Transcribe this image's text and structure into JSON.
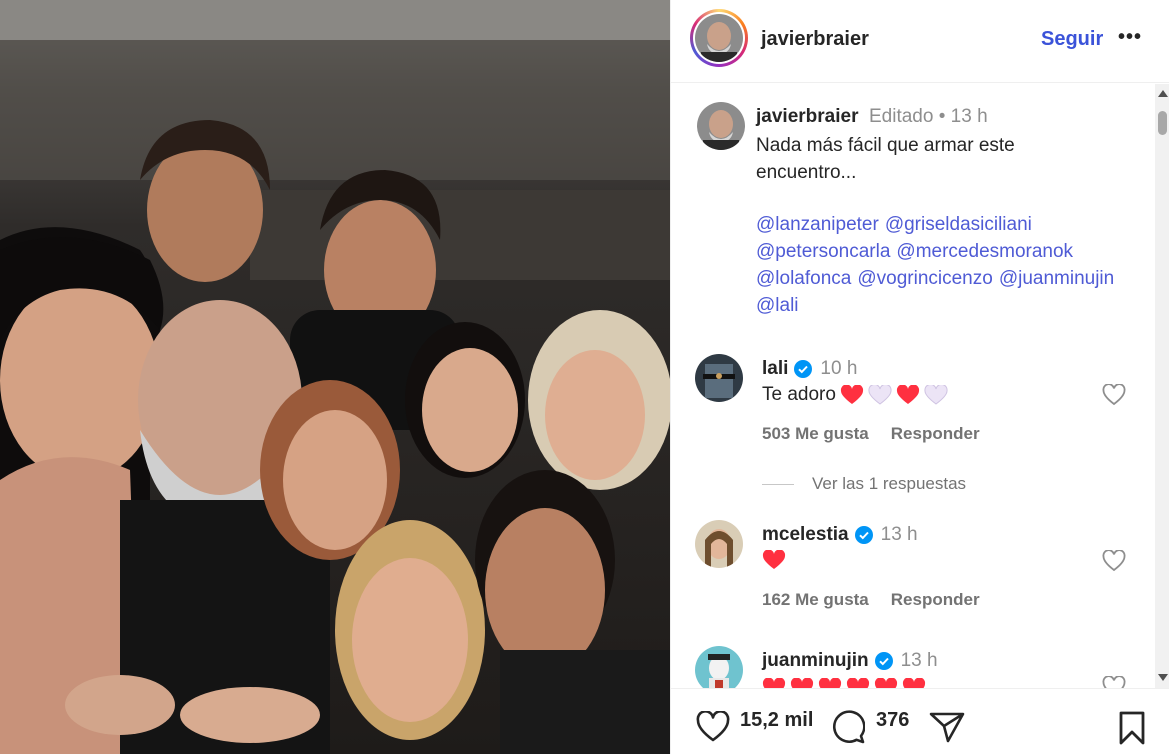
{
  "post": {
    "photo_alt": "Group selfie photo",
    "header": {
      "username": "javierbraier",
      "follow_label": "Seguir",
      "more_label": "•••"
    },
    "caption": {
      "username": "javierbraier",
      "edited": "Editado • 13 h",
      "text": "Nada más fácil que armar este\nencuentro...",
      "mentions": [
        "@lanzanipeter",
        "@griseldasiciliani",
        "@petersoncarla",
        "@mercedesmoranok",
        "@lolafonca",
        "@vogrincicenzo",
        "@juanminujin",
        "@lali"
      ]
    },
    "comments": [
      {
        "username": "lali",
        "time": "10 h",
        "verified": true,
        "text": "Te adoro",
        "emojis": [
          "heart-red",
          "heart-white",
          "heart-red",
          "heart-white"
        ],
        "likes": "503 Me gusta",
        "reply": "Responder",
        "view_replies": "Ver las 1 respuestas"
      },
      {
        "username": "mcelestia",
        "time": "13 h",
        "verified": true,
        "text": "",
        "emojis": [
          "heart-red"
        ],
        "likes": "162 Me gusta",
        "reply": "Responder"
      },
      {
        "username": "juanminujin",
        "time": "13 h",
        "verified": true,
        "text": "",
        "emojis": [
          "heart-red",
          "heart-red",
          "heart-red",
          "heart-red",
          "heart-red",
          "heart-red"
        ]
      }
    ],
    "footer": {
      "likes_count": "15,2 mil",
      "comments_count": "376"
    },
    "colors": {
      "link": "#3b53d9",
      "mention": "#4f5bd5",
      "verified": "#0095f6",
      "heart": "#ff3040",
      "muted": "#737373"
    },
    "icons": [
      "heart-icon",
      "comment-icon",
      "share-icon",
      "bookmark-icon",
      "verified-icon",
      "more-icon"
    ]
  }
}
